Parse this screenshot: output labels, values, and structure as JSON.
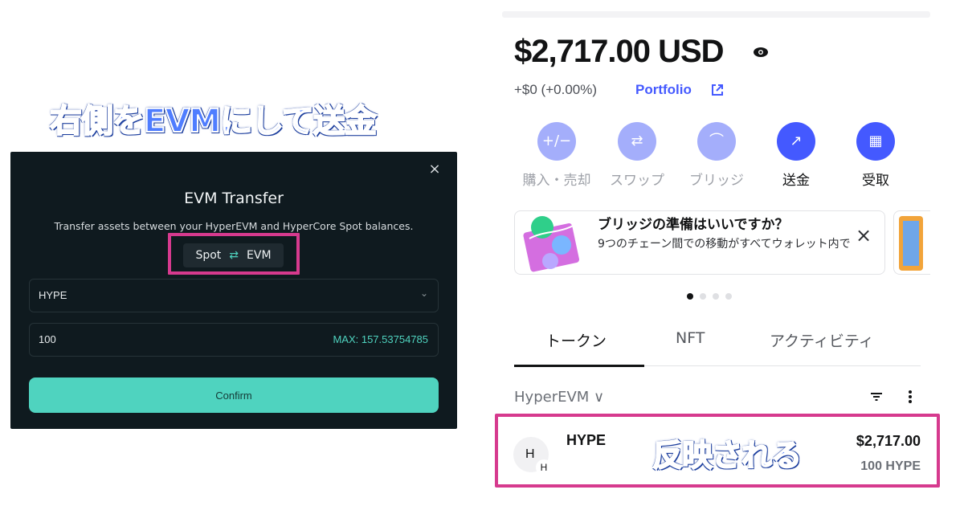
{
  "annotations": {
    "left_title": "右側をEVMにして送金",
    "reflected": "反映される"
  },
  "transfer_modal": {
    "close_icon": "×",
    "title": "EVM Transfer",
    "description": "Transfer assets between your HyperEVM and HyperCore Spot balances.",
    "toggle": {
      "from": "Spot",
      "swap_icon": "⇄",
      "to": "EVM"
    },
    "token_select": {
      "value": "HYPE",
      "chevron": "⌄"
    },
    "amount": {
      "value": "100",
      "max_label": "MAX: 157.53754785"
    },
    "confirm_label": "Confirm"
  },
  "wallet": {
    "balance": "$2,717.00 USD",
    "change": "+$0 (+0.00%)",
    "portfolio_label": "Portfolio",
    "actions": [
      {
        "label": "購入・売却",
        "icon": "+/−"
      },
      {
        "label": "スワップ",
        "icon": "⇄"
      },
      {
        "label": "ブリッジ",
        "icon": "⌒"
      },
      {
        "label": "送金",
        "icon": "↗"
      },
      {
        "label": "受取",
        "icon": "▦"
      }
    ],
    "banner": {
      "title": "ブリッジの準備はいいですか？",
      "text": "9つのチェーン間での移動がすべてウォレット内で",
      "close_icon": "×"
    },
    "tabs": [
      "トークン",
      "NFT",
      "アクティビティ"
    ],
    "network": "HyperEVM",
    "network_chevron": "∨",
    "token_row": {
      "avatar_letter": "H",
      "badge_letter": "H",
      "name": "HYPE",
      "fiat": "$2,717.00",
      "amount": "100 HYPE"
    }
  },
  "colors": {
    "accent_teal": "#4fd3bf",
    "accent_blue": "#4459ff",
    "highlight_pink": "#d63a8e",
    "modal_bg": "#0f1a1f"
  }
}
